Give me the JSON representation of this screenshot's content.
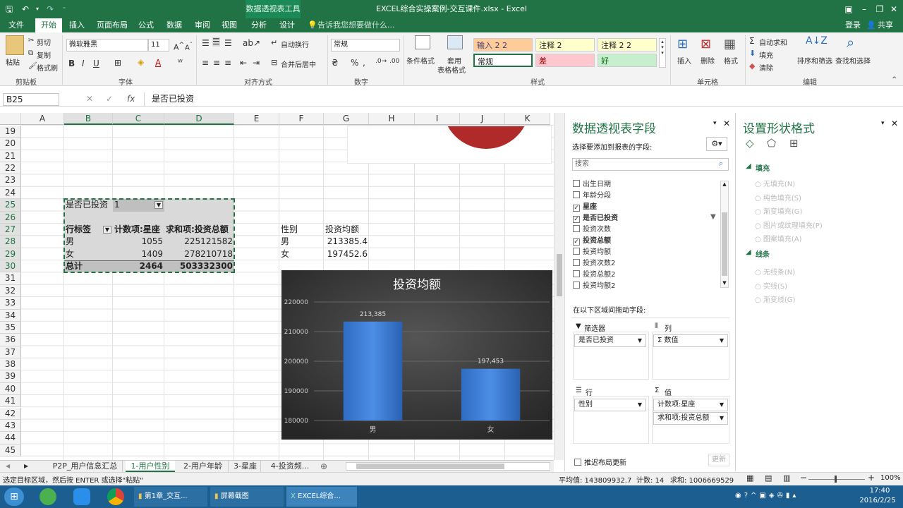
{
  "titlebar": {
    "context_tab": "数据透视表工具",
    "title": "EXCEL综合实操案例-交互课件.xlsx - Excel",
    "save_icon": "save-icon",
    "undo_icon": "undo-icon"
  },
  "ribbon_tabs": [
    {
      "label": "文件"
    },
    {
      "label": "开始"
    },
    {
      "label": "插入"
    },
    {
      "label": "页面布局"
    },
    {
      "label": "公式"
    },
    {
      "label": "数据"
    },
    {
      "label": "审阅"
    },
    {
      "label": "视图"
    },
    {
      "label": "分析"
    },
    {
      "label": "设计"
    }
  ],
  "tell_me": "告诉我您想要做什么...",
  "login": "登录",
  "share": "共享",
  "ribbon": {
    "paste": "粘贴",
    "cut": "剪切",
    "copy": "复制",
    "format_painter": "格式刷",
    "clipboard": "剪贴板",
    "font_name": "微软雅黑",
    "font_size": "11",
    "font": "字体",
    "wrap_text": "自动换行",
    "merge_center": "合并后居中",
    "alignment": "对齐方式",
    "number_format": "常规",
    "number": "数字",
    "cond_format": "条件格式",
    "format_table_1": "套用",
    "format_table_2": "表格格式",
    "styles_label": "样式",
    "style_input": "输入 2 2",
    "style_note1": "注释 2",
    "style_note2": "注释 2 2",
    "style_normal": "常规",
    "style_bad": "差",
    "style_good": "好",
    "insert": "插入",
    "delete": "删除",
    "format": "格式",
    "cells": "单元格",
    "autosum": "自动求和",
    "fill": "填充",
    "clear": "清除",
    "sort_filter": "排序和筛选",
    "find_select": "查找和选择",
    "editing": "编辑"
  },
  "formula_bar": {
    "name_box": "B25",
    "fx": "fx",
    "value": "是否已投资"
  },
  "columns": [
    "A",
    "B",
    "C",
    "D",
    "E",
    "F",
    "G",
    "H",
    "I",
    "J",
    "K"
  ],
  "rows": [
    "19",
    "20",
    "21",
    "22",
    "23",
    "24",
    "25",
    "26",
    "27",
    "28",
    "29",
    "30",
    "31",
    "32",
    "33",
    "34",
    "35",
    "36",
    "37",
    "38",
    "39",
    "40",
    "41",
    "42",
    "43",
    "44",
    "45"
  ],
  "pivot": {
    "filter_label": "是否已投资",
    "filter_value": "1",
    "header_row": "行标签",
    "header_count": "计数项:星座",
    "header_sum": "求和项:投资总额",
    "rows": [
      {
        "label": "男",
        "count": "1055",
        "sum": "225121582"
      },
      {
        "label": "女",
        "count": "1409",
        "sum": "278210718"
      }
    ],
    "total": {
      "label": "总计",
      "count": "2464",
      "sum": "503332300"
    }
  },
  "side_table": {
    "h1": "性别",
    "h2": "投资均额",
    "rows": [
      {
        "k": "男",
        "v": "213385.4"
      },
      {
        "k": "女",
        "v": "197452.6"
      }
    ]
  },
  "chart_data": {
    "type": "bar",
    "title": "投资均额",
    "categories": [
      "男",
      "女"
    ],
    "values": [
      213385,
      197453
    ],
    "data_labels": [
      "213,385",
      "197,453"
    ],
    "ylim": [
      180000,
      220000
    ],
    "yticks": [
      "180000",
      "190000",
      "200000",
      "210000",
      "220000"
    ],
    "grid": true,
    "colors": {
      "bar": "#3a7bd5",
      "bg": "#3a3a3a"
    }
  },
  "pivot_pane": {
    "title": "数据透视表字段",
    "subtitle": "选择要添加到报表的字段:",
    "search_placeholder": "搜索",
    "fields": [
      {
        "label": "出生日期",
        "checked": false
      },
      {
        "label": "年龄分段",
        "checked": false
      },
      {
        "label": "星座",
        "checked": true
      },
      {
        "label": "是否已投资",
        "checked": true
      },
      {
        "label": "投资次数",
        "checked": false
      },
      {
        "label": "投资总额",
        "checked": true
      },
      {
        "label": "投资均额",
        "checked": false
      },
      {
        "label": "投资次数2",
        "checked": false
      },
      {
        "label": "投资总额2",
        "checked": false
      },
      {
        "label": "投资均额2",
        "checked": false
      }
    ],
    "drag_label": "在以下区域间拖动字段:",
    "filters_label": "筛选器",
    "columns_label": "列",
    "rows_label": "行",
    "values_label": "值",
    "filter_item": "是否已投资",
    "column_item": "Σ 数值",
    "row_item": "性别",
    "value_item1": "计数项:星座",
    "value_item2": "求和项:投资总额",
    "defer_label": "推迟布局更新",
    "update_button": "更新"
  },
  "format_pane": {
    "title": "设置形状格式",
    "fill_section": "填充",
    "fill_options": [
      "无填充(N)",
      "纯色填充(S)",
      "渐变填充(G)",
      "图片或纹理填充(P)",
      "图案填充(A)"
    ],
    "line_section": "线条",
    "line_options": [
      "无线条(N)",
      "实线(S)",
      "渐变线(G)"
    ]
  },
  "sheet_tabs": [
    "P2P_用户信息汇总",
    "1-用户性别",
    "2-用户年龄",
    "3-星座",
    "4-投资频..."
  ],
  "status": {
    "message": "选定目标区域，然后按 ENTER 或选择\"粘贴\"",
    "average": "平均值: 143809932.7",
    "count": "计数: 14",
    "sum": "求和: 1006669529",
    "zoom": "100%"
  },
  "taskbar": {
    "items": [
      "第1章_交互...",
      "屏幕截图",
      "EXCEL综合..."
    ],
    "time": "17:40",
    "date": "2016/2/25"
  }
}
